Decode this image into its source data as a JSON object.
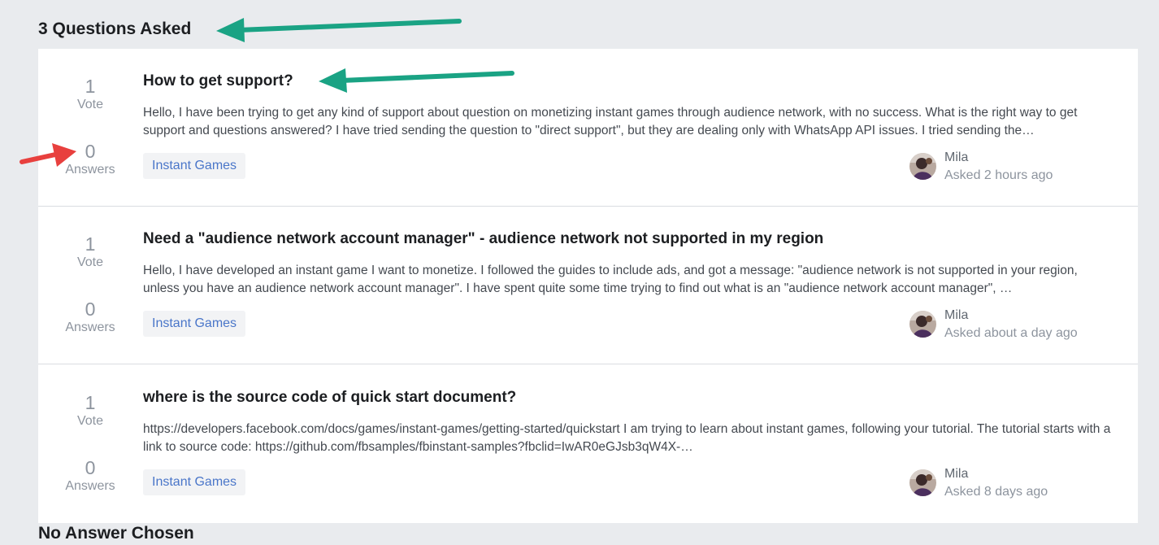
{
  "section": {
    "title": "3 Questions Asked",
    "next_title_cut": "No Answer Chosen"
  },
  "questions": [
    {
      "votes": "1",
      "votes_label": "Vote",
      "answers": "0",
      "answers_label": "Answers",
      "title": "How to get support?",
      "excerpt": "Hello, I have been trying to get any kind of support about question on monetizing instant games through audience network, with no success. What is the right way to get support and questions answered? I have tried sending the question to \"direct support\", but they are dealing only with WhatsApp API issues. I tried sending the…",
      "tag": "Instant Games",
      "author": "Mila",
      "asked": "Asked 2 hours ago"
    },
    {
      "votes": "1",
      "votes_label": "Vote",
      "answers": "0",
      "answers_label": "Answers",
      "title": "Need a \"audience network account manager\" - audience network not supported in my region",
      "excerpt": "Hello, I have developed an instant game I want to monetize. I followed the guides to include ads, and got a message: \"audience network is not supported in your region, unless you have an audience network account manager\". I have spent quite some time trying to find out what is an \"audience network account manager\", …",
      "tag": "Instant Games",
      "author": "Mila",
      "asked": "Asked about a day ago"
    },
    {
      "votes": "1",
      "votes_label": "Vote",
      "answers": "0",
      "answers_label": "Answers",
      "title": "where is the source code of quick start document?",
      "excerpt": "https://developers.facebook.com/docs/games/instant-games/getting-started/quickstart I am trying to learn about instant games, following your tutorial. The tutorial starts with a link to source code: https://github.com/fbsamples/fbinstant-samples?fbclid=IwAR0eGJsb3qW4X-…",
      "tag": "Instant Games",
      "author": "Mila",
      "asked": "Asked 8 days ago"
    }
  ],
  "colors": {
    "annotation_green": "#1aa384",
    "annotation_red": "#e8403e",
    "tag_text": "#4a76c9",
    "background": "#e9ebee"
  },
  "icons": {
    "avatar": "user-avatar-icon",
    "annotation_arrows": [
      "green-arrow-icon",
      "red-arrow-icon"
    ]
  }
}
